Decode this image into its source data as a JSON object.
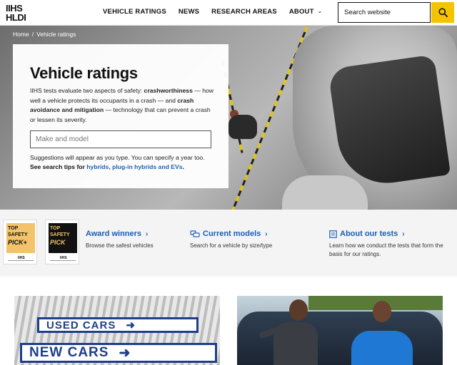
{
  "header": {
    "logo": {
      "line1": "IIHS",
      "line2": "HLDI"
    },
    "nav": [
      {
        "label": "VEHICLE RATINGS"
      },
      {
        "label": "NEWS"
      },
      {
        "label": "RESEARCH AREAS"
      },
      {
        "label": "ABOUT",
        "has_dropdown": true
      }
    ],
    "search": {
      "placeholder": "Search website",
      "value": "",
      "button_icon": "search-icon"
    },
    "accent": "#f5c400"
  },
  "hero": {
    "breadcrumb": [
      "Home",
      "/",
      "Vehicle ratings"
    ],
    "title": "Vehicle ratings",
    "desc_1": "IIHS tests evaluate two aspects of safety: ",
    "desc_b1": "crashworthiness",
    "desc_2": " — how well a vehicle protects its occupants in a crash — and ",
    "desc_b2": "crash avoidance and mitigation",
    "desc_3": " — technology that can prevent a crash or lessen its severity.",
    "input_placeholder": "Make and model",
    "input_value": "",
    "hint": "Suggestions will appear as you type. You can specify a year too.",
    "tips_prefix": "See search tips for ",
    "tips_link": "hybrids, plug-in hybrids and EVs",
    "tips_suffix": "."
  },
  "features": {
    "badges": [
      {
        "line1": "TOP",
        "line2": "SAFETY",
        "line3": "PICK+",
        "color": "#f2c36a",
        "text_color": "#111"
      },
      {
        "line1": "TOP",
        "line2": "SAFETY",
        "line3": "PICK",
        "color": "#111111",
        "text_color": "#f2c36a"
      }
    ],
    "badge_footer": "IIHS",
    "items": [
      {
        "title": "Award winners",
        "desc": "Browse the safest vehicles",
        "icon": ""
      },
      {
        "title": "Current models",
        "desc": "Search for a vehicle by size/type",
        "icon": "car-icon"
      },
      {
        "title": "About our tests",
        "desc": "Learn how we conduct the tests that form the basis for our ratings.",
        "icon": "document-icon"
      }
    ],
    "link_color": "#1a5fb4"
  },
  "cards": {
    "left": {
      "sign1": "USED CARS",
      "sign2": "NEW CARS"
    },
    "right": {}
  }
}
